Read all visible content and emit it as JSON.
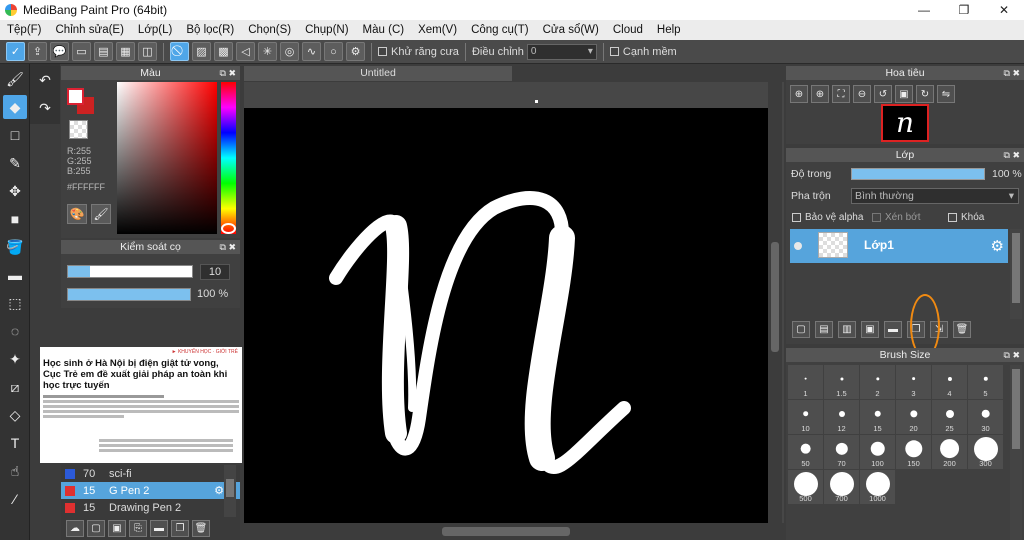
{
  "window": {
    "title": "MediBang Paint Pro (64bit)",
    "minimize": "—",
    "maximize": "❐",
    "close": "✕"
  },
  "menu": [
    "Tệp(F)",
    "Chỉnh sửa(E)",
    "Lớp(L)",
    "Bộ lọc(R)",
    "Chọn(S)",
    "Chụp(N)",
    "Màu (C)",
    "Xem(V)",
    "Công cụ(T)",
    "Cửa sổ(W)",
    "Cloud",
    "Help"
  ],
  "toolbar": {
    "antialias_label": "Khử răng cưa",
    "correction_label": "Điều chỉnh",
    "correction_value": "0",
    "soft_edge_label": "Cạnh mềm"
  },
  "color_panel": {
    "title": "Màu",
    "r": "R:255",
    "g": "G:255",
    "b": "B:255",
    "hex": "#FFFFFF",
    "fg_color": "#ffffff",
    "bg_color": "#cc2222"
  },
  "brush_control": {
    "title": "Kiểm soát cọ",
    "size_value": "10",
    "size_fill": 0.18,
    "opacity_value": "100 %",
    "opacity_fill": 1.0
  },
  "news_overlay": {
    "tags": "► KHUYẾN HỌC · GIỚI TRẺ",
    "headline": "Học sinh ở Hà Nội bị điện giật tử vong, Cục Trẻ em đề xuất giải pháp an toàn khi học trực tuyến"
  },
  "brush_list": {
    "items": [
      {
        "num": "70",
        "name": "sci-fi",
        "color": "#2c5ad8",
        "selected": false
      },
      {
        "num": "15",
        "name": "G Pen 2",
        "color": "#e03030",
        "selected": true
      },
      {
        "num": "15",
        "name": "Drawing Pen 2",
        "color": "#e03030",
        "selected": false
      }
    ]
  },
  "document": {
    "tab": "Untitled"
  },
  "navigator": {
    "title": "Hoa tiêu",
    "thumb_glyph": "n"
  },
  "layer_panel": {
    "title": "Lớp",
    "opacity_label": "Độ trong",
    "opacity_value": "100 %",
    "blend_label": "Pha trộn",
    "blend_value": "Bình thường",
    "protect_alpha": "Bảo vệ alpha",
    "clipping": "Xén bớt",
    "lock": "Khóa",
    "layer_name": "Lớp1"
  },
  "brush_size": {
    "title": "Brush Size",
    "sizes": [
      "1",
      "1.5",
      "2",
      "3",
      "4",
      "5",
      "10",
      "12",
      "15",
      "20",
      "25",
      "30",
      "50",
      "70",
      "100",
      "150",
      "200",
      "300",
      "500",
      "700",
      "1000"
    ]
  },
  "accent": "#4fa6e8",
  "highlight_color": "#f08a12"
}
